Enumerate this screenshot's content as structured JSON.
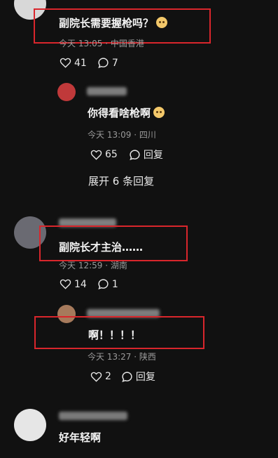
{
  "comments": [
    {
      "text": "副院长需要握枪吗？",
      "meta": "今天 13:05 · 中国香港",
      "likes": "41",
      "replies": "7"
    },
    {
      "text": "你得看啥枪啊",
      "meta": "今天 13:09 · 四川",
      "likes": "65",
      "reply_label": "回复"
    },
    {
      "expand": "展开 6 条回复"
    },
    {
      "text": "副院长才主治……",
      "meta": "今天 12:59 · 湖南",
      "likes": "14",
      "replies": "1"
    },
    {
      "text": "啊！！！！",
      "meta": "今天 13:27 · 陕西",
      "likes": "2",
      "reply_label": "回复"
    },
    {
      "text": "好年轻啊"
    }
  ],
  "colors": {
    "background": "#111111",
    "highlight": "#d9262c",
    "meta": "#9a9a9a"
  },
  "icons": [
    "heart-icon",
    "comment-icon",
    "emoji-icon"
  ]
}
